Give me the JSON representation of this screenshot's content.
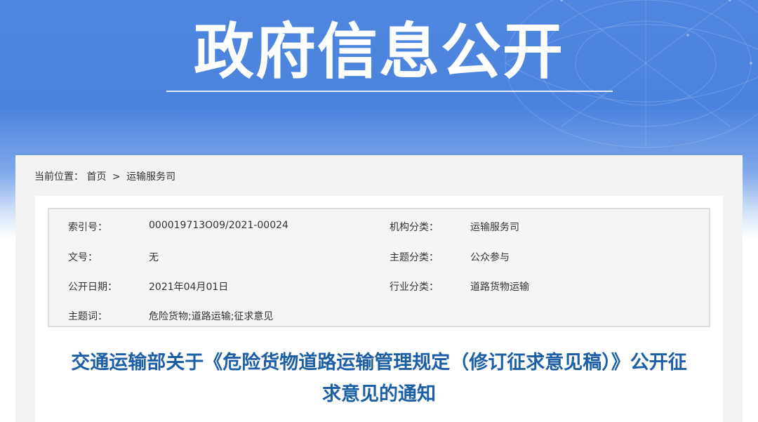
{
  "banner": {
    "title": "政府信息公开"
  },
  "breadcrumb": {
    "prefix": "当前位置：",
    "home": "首页",
    "separator": ">",
    "current": "运输服务司"
  },
  "meta": {
    "index_label": "索引号：",
    "index_value": "000019713O09/2021-00024",
    "org_label": "机构分类：",
    "org_value": "运输服务司",
    "doc_no_label": "文号：",
    "doc_no_value": "无",
    "topic_label": "主题分类：",
    "topic_value": "公众参与",
    "date_label": "公开日期：",
    "date_value": "2021年04月01日",
    "industry_label": "行业分类：",
    "industry_value": "道路货物运输",
    "keywords_label": "主题词：",
    "keywords_value": "危险货物;道路运输;征求意见"
  },
  "document": {
    "title_line1": "交通运输部关于《危险货物道路运输管理规定（修订征求意见稿）》公开征",
    "title_line2": "求意见的通知"
  },
  "colors": {
    "banner_blue": "#4a83dd",
    "title_blue": "#1d5fa6",
    "panel_gray": "#f3f3f3"
  }
}
